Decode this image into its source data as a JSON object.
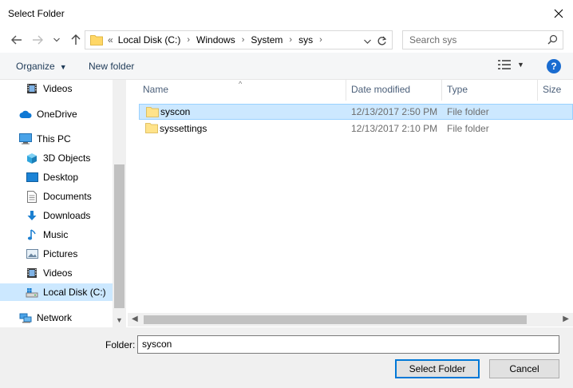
{
  "window": {
    "title": "Select Folder"
  },
  "address": {
    "overflow": "«",
    "crumbs": [
      "Local Disk (C:)",
      "Windows",
      "System",
      "sys"
    ]
  },
  "search": {
    "placeholder": "Search sys"
  },
  "toolbar": {
    "organize": "Organize",
    "new_folder": "New folder",
    "help": "?"
  },
  "nav": {
    "items": [
      {
        "label": "Videos",
        "icon": "video-icon"
      },
      {
        "label": "OneDrive",
        "icon": "cloud-icon"
      },
      {
        "label": "This PC",
        "icon": "computer-icon"
      },
      {
        "label": "3D Objects",
        "icon": "cube-icon"
      },
      {
        "label": "Desktop",
        "icon": "desktop-icon"
      },
      {
        "label": "Documents",
        "icon": "document-icon"
      },
      {
        "label": "Downloads",
        "icon": "download-icon"
      },
      {
        "label": "Music",
        "icon": "music-icon"
      },
      {
        "label": "Pictures",
        "icon": "picture-icon"
      },
      {
        "label": "Videos",
        "icon": "video-icon"
      },
      {
        "label": "Local Disk (C:)",
        "icon": "drive-icon",
        "selected": true
      },
      {
        "label": "Network",
        "icon": "network-icon"
      }
    ]
  },
  "files": {
    "columns": [
      "Name",
      "Date modified",
      "Type",
      "Size"
    ],
    "rows": [
      {
        "name": "syscon",
        "date": "12/13/2017 2:50 PM",
        "type": "File folder",
        "selected": true
      },
      {
        "name": "syssettings",
        "date": "12/13/2017 2:10 PM",
        "type": "File folder",
        "selected": false
      }
    ]
  },
  "footer": {
    "folder_label": "Folder:",
    "folder_value": "syscon",
    "select_button": "Select Folder",
    "cancel_button": "Cancel"
  },
  "colors": {
    "selection": "#cce8ff",
    "accent": "#0078d7",
    "folder": "#ffe38a"
  }
}
